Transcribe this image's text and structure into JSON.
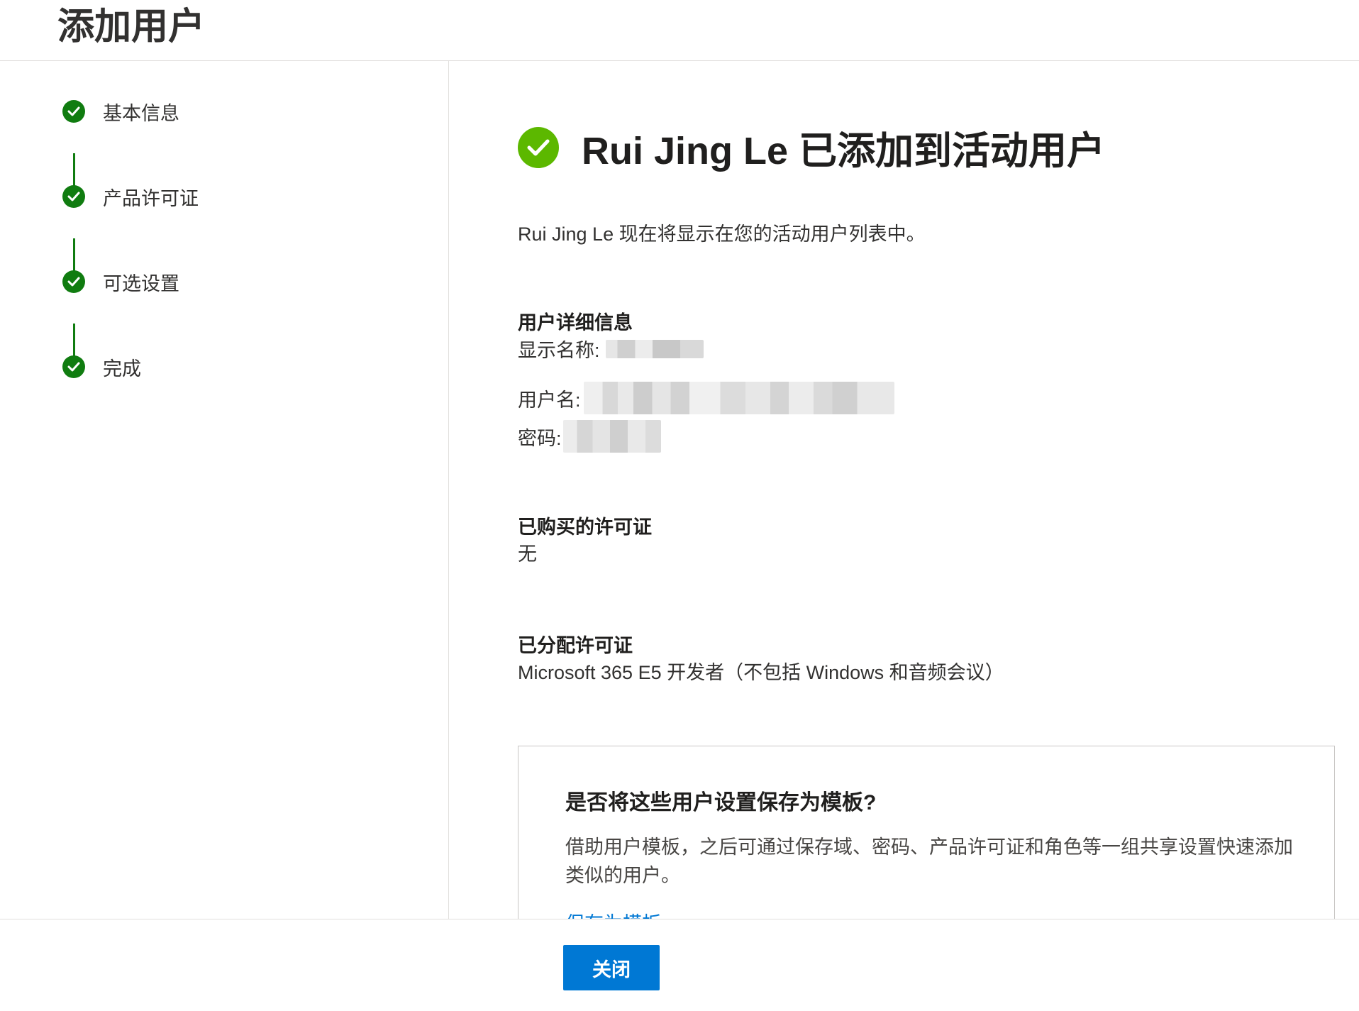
{
  "header": {
    "title": "添加用户"
  },
  "steps": [
    {
      "label": "基本信息",
      "status": "complete"
    },
    {
      "label": "产品许可证",
      "status": "complete"
    },
    {
      "label": "可选设置",
      "status": "complete"
    },
    {
      "label": "完成",
      "status": "complete"
    }
  ],
  "main": {
    "success_title": "Rui Jing Le 已添加到活动用户",
    "description": "Rui Jing Le 现在将显示在您的活动用户列表中。",
    "user_details": {
      "heading": "用户详细信息",
      "display_name_label": "显示名称:",
      "username_label": "用户名:",
      "password_label": "密码:"
    },
    "purchased": {
      "heading": "已购买的许可证",
      "value": "无"
    },
    "assigned": {
      "heading": "已分配许可证",
      "value": "Microsoft 365 E5 开发者（不包括 Windows 和音频会议）"
    },
    "template_card": {
      "title": "是否将这些用户设置保存为模板?",
      "text": "借助用户模板，之后可通过保存域、密码、产品许可证和角色等一组共享设置快速添加类似的用户。",
      "link": "保存为模板"
    }
  },
  "footer": {
    "close_label": "关闭"
  },
  "colors": {
    "step_green": "#107c10",
    "success_green": "#5cb800",
    "primary_blue": "#0078d4"
  },
  "icons": {
    "step": "check-circle-icon",
    "success": "check-circle-icon"
  }
}
